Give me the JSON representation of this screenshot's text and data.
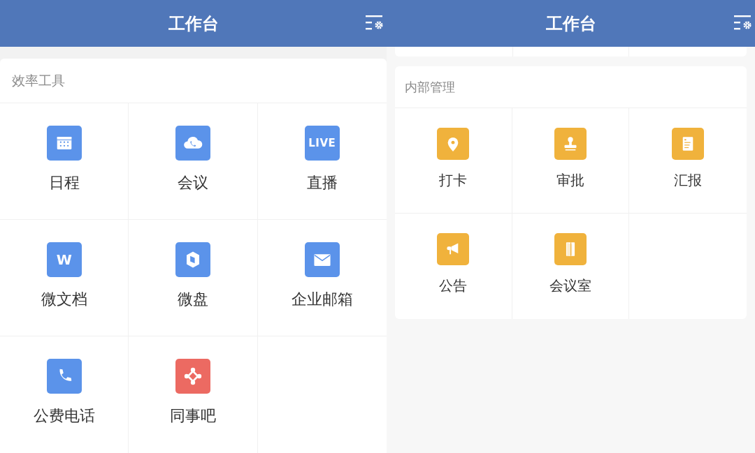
{
  "screens": [
    {
      "header": {
        "title": "工作台"
      },
      "section": {
        "title": "效率工具",
        "items": [
          {
            "label": "日程",
            "kind": "calendar",
            "color": "#5b93ea"
          },
          {
            "label": "会议",
            "kind": "cloud-phone",
            "color": "#5b93ea"
          },
          {
            "label": "直播",
            "kind": "live",
            "icon_text": "LIVE",
            "color": "#5b93ea"
          },
          {
            "label": "微文档",
            "kind": "letter",
            "icon_text": "W",
            "color": "#5b93ea"
          },
          {
            "label": "微盘",
            "kind": "cube",
            "color": "#5b93ea"
          },
          {
            "label": "企业邮箱",
            "kind": "mail",
            "color": "#5b93ea"
          },
          {
            "label": "公费电话",
            "kind": "phone",
            "color": "#5b93ea"
          },
          {
            "label": "同事吧",
            "kind": "network",
            "color": "#ec6a62"
          }
        ]
      }
    },
    {
      "header": {
        "title": "工作台"
      },
      "section": {
        "title": "内部管理",
        "items": [
          {
            "label": "打卡",
            "kind": "pin",
            "color": "#f0b23c"
          },
          {
            "label": "审批",
            "kind": "stamp",
            "color": "#f0b23c"
          },
          {
            "label": "汇报",
            "kind": "document",
            "color": "#f0b23c"
          },
          {
            "label": "公告",
            "kind": "megaphone",
            "color": "#f0b23c"
          },
          {
            "label": "会议室",
            "kind": "door",
            "color": "#f0b23c"
          }
        ]
      }
    }
  ]
}
